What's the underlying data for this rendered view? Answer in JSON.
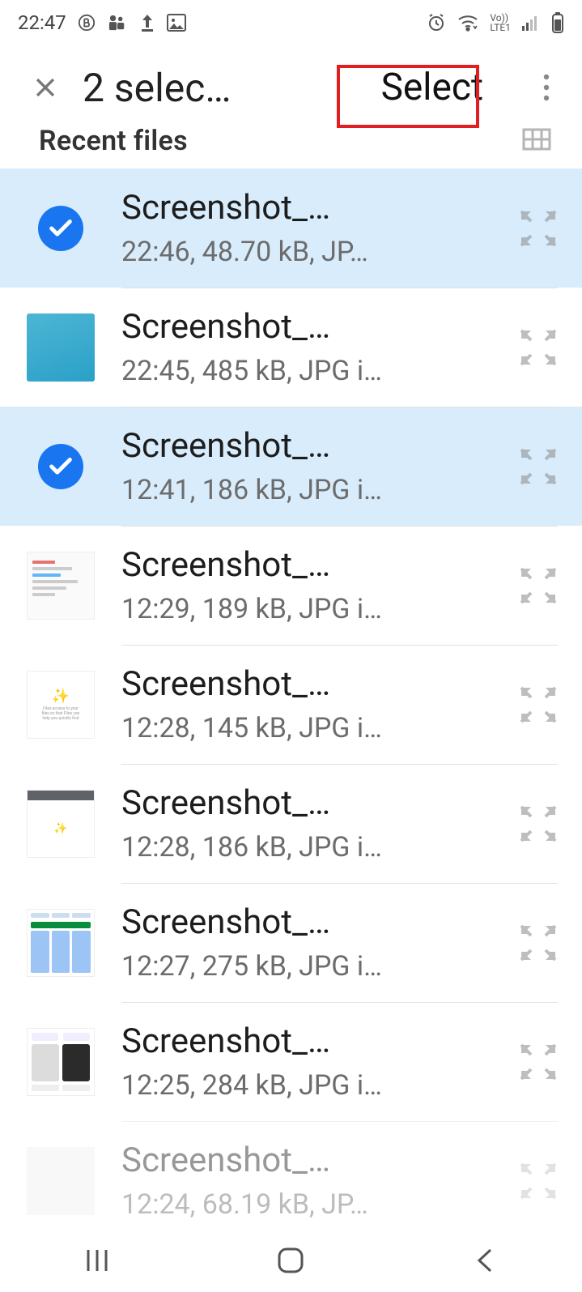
{
  "statusbar": {
    "time": "22:47",
    "network_label_top": "Vo))",
    "network_label_bottom": "LTE1"
  },
  "appbar": {
    "title": "2 selec…",
    "select_label": "Select"
  },
  "section": {
    "title": "Recent files"
  },
  "files": [
    {
      "name": "Screenshot_…",
      "meta": "22:46, 48.70 kB, JP…",
      "selected": true,
      "thumb": "check"
    },
    {
      "name": "Screenshot_…",
      "meta": "22:45, 485 kB, JPG i…",
      "selected": false,
      "thumb": "pool"
    },
    {
      "name": "Screenshot_…",
      "meta": "12:41, 186 kB, JPG i…",
      "selected": true,
      "thumb": "check"
    },
    {
      "name": "Screenshot_…",
      "meta": "12:29, 189 kB, JPG i…",
      "selected": false,
      "thumb": "doc"
    },
    {
      "name": "Screenshot_…",
      "meta": "12:28, 145 kB, JPG i…",
      "selected": false,
      "thumb": "welcome"
    },
    {
      "name": "Screenshot_…",
      "meta": "12:28, 186 kB, JPG i…",
      "selected": false,
      "thumb": "app"
    },
    {
      "name": "Screenshot_…",
      "meta": "12:27, 275 kB, JPG i…",
      "selected": false,
      "thumb": "shots"
    },
    {
      "name": "Screenshot_…",
      "meta": "12:25, 284 kB, JPG i…",
      "selected": false,
      "thumb": "gallery"
    },
    {
      "name": "Screenshot_…",
      "meta": "12:24, 68.19 kB, JP…",
      "selected": false,
      "thumb": "blank",
      "faded": true
    }
  ]
}
